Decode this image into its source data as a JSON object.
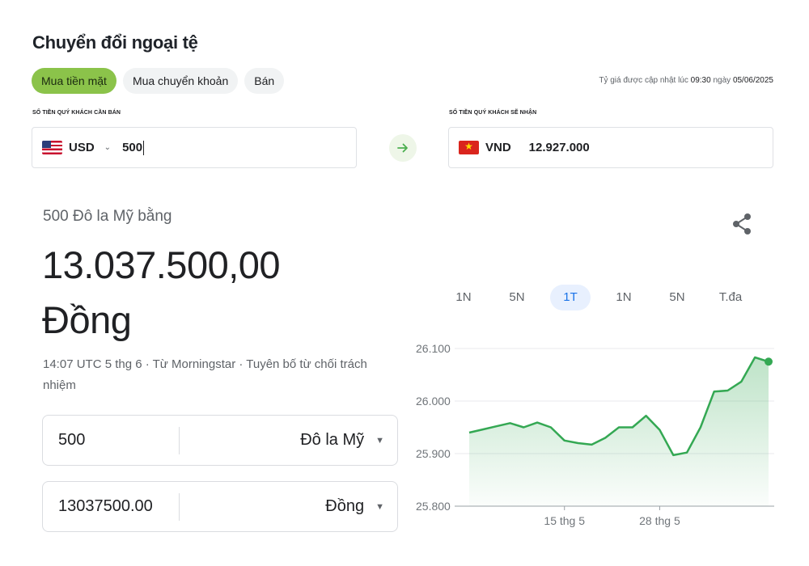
{
  "page": {
    "title": "Chuyển đổi ngoại tệ",
    "tabs": [
      {
        "label": "Mua tiền mặt",
        "active": true
      },
      {
        "label": "Mua chuyển khoản",
        "active": false
      },
      {
        "label": "Bán",
        "active": false
      }
    ],
    "update_note": {
      "prefix": "Tỷ giá được cập nhật lúc ",
      "time": "09:30",
      "mid": " ngày ",
      "date": "05/06/2025"
    }
  },
  "converter": {
    "from_label": "SỐ TIỀN QUÝ KHÁCH CẦN BÁN",
    "to_label": "SỐ TIỀN QUÝ KHÁCH SẼ NHẬN",
    "from_currency": "USD",
    "from_amount": "500",
    "to_currency": "VND",
    "to_amount": "12.927.000",
    "swap_icon": "arrow-right-icon",
    "chevron": "⌄"
  },
  "widget": {
    "subtitle": "500 Đô la Mỹ bằng",
    "value": "13.037.500,00",
    "unit": "Đồng",
    "meta": "14:07 UTC 5 thg 6 · Từ Morningstar · Tuyên bố từ chối trách nhiệm",
    "share_icon": "share-icon",
    "from_value": "500",
    "from_unit": "Đô la Mỹ",
    "to_value": "13037500.00",
    "to_unit": "Đồng",
    "dropdown_icon": "▼",
    "ranges": [
      "1N",
      "5N",
      "1T",
      "1N",
      "5N",
      "T.đa"
    ],
    "active_range": 2,
    "accent": "#34a853"
  },
  "chart_data": {
    "type": "area",
    "y_ticks": [
      "26.100",
      "26.000",
      "25.900",
      "25.800"
    ],
    "ylim": [
      25800,
      26100
    ],
    "x_ticks": [
      "15 thg 5",
      "28 thg 5"
    ],
    "values": [
      25940,
      25946,
      25952,
      25958,
      25950,
      25959,
      25950,
      25925,
      25920,
      25917,
      25930,
      25950,
      25950,
      25972,
      25945,
      25897,
      25902,
      25950,
      26018,
      26020,
      26037,
      26083,
      26075
    ],
    "color": "#34a853",
    "grid": true
  }
}
